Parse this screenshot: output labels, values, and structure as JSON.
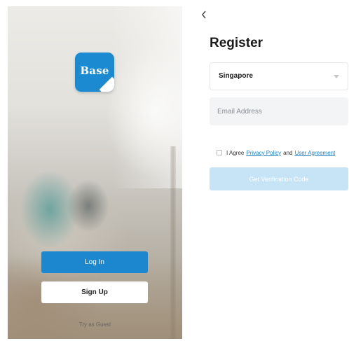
{
  "welcome": {
    "logo_text": "Base",
    "login_label": "Log In",
    "signup_label": "Sign Up",
    "guest_label": "Try as Guest"
  },
  "register": {
    "back_icon": "chevron-left-icon",
    "title": "Register",
    "country": "Singapore",
    "email_placeholder": "Email Address",
    "agree_prefix": "I Agree",
    "privacy_link": "Privacy Policy",
    "agree_and": "and",
    "agreement_link": "User Agreement",
    "verify_label": "Get Verification Code"
  },
  "colors": {
    "primary": "#1c86cf",
    "link": "#1c7fc8",
    "disabled_button": "#c6e4f6",
    "field_bg": "#f2f4f6"
  }
}
